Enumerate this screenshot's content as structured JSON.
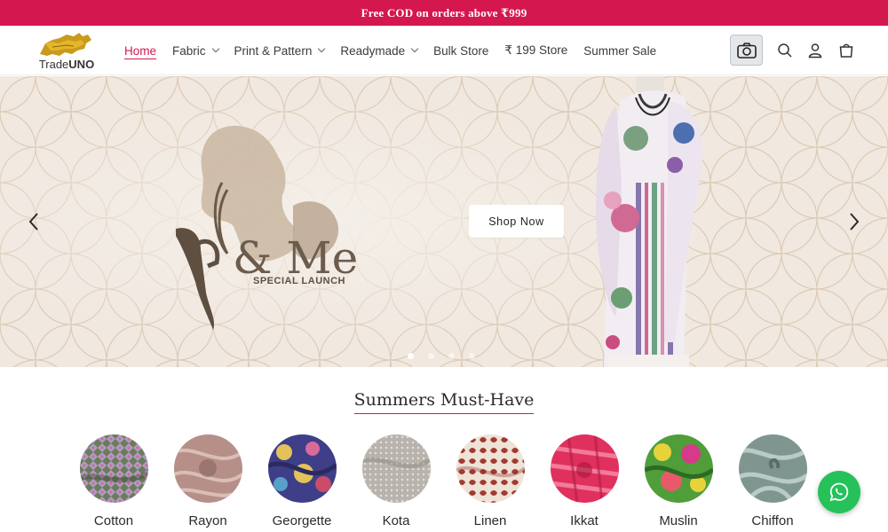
{
  "announcement": {
    "text": "Free COD on orders above ₹999"
  },
  "logo": {
    "brand_prefix": "Trade",
    "brand_suffix": "UNO"
  },
  "nav": {
    "items": [
      {
        "label": "Home",
        "active": true,
        "dropdown": false
      },
      {
        "label": "Fabric",
        "active": false,
        "dropdown": true
      },
      {
        "label": "Print & Pattern",
        "active": false,
        "dropdown": true
      },
      {
        "label": "Readymade",
        "active": false,
        "dropdown": true
      },
      {
        "label": "Bulk Store",
        "active": false,
        "dropdown": false
      },
      {
        "label": "₹ 199 Store",
        "active": false,
        "dropdown": false
      },
      {
        "label": "Summer Sale",
        "active": false,
        "dropdown": false
      }
    ]
  },
  "header_icons": [
    "camera-icon",
    "search-icon",
    "account-icon",
    "cart-icon"
  ],
  "hero": {
    "brand_text": "& Me",
    "tagline": "SPECIAL LAUNCH",
    "cta_label": "Shop Now",
    "slide_count": 4,
    "active_slide": 1
  },
  "summers": {
    "title": "Summers Must-Have",
    "categories": [
      {
        "label": "Cotton"
      },
      {
        "label": "Rayon"
      },
      {
        "label": "Georgette"
      },
      {
        "label": "Kota"
      },
      {
        "label": "Linen"
      },
      {
        "label": "Ikkat"
      },
      {
        "label": "Muslin"
      },
      {
        "label": "Chiffon"
      }
    ]
  },
  "colors": {
    "accent": "#d4174f",
    "whatsapp": "#25c25a",
    "hero_bg": "#f1e8df"
  }
}
